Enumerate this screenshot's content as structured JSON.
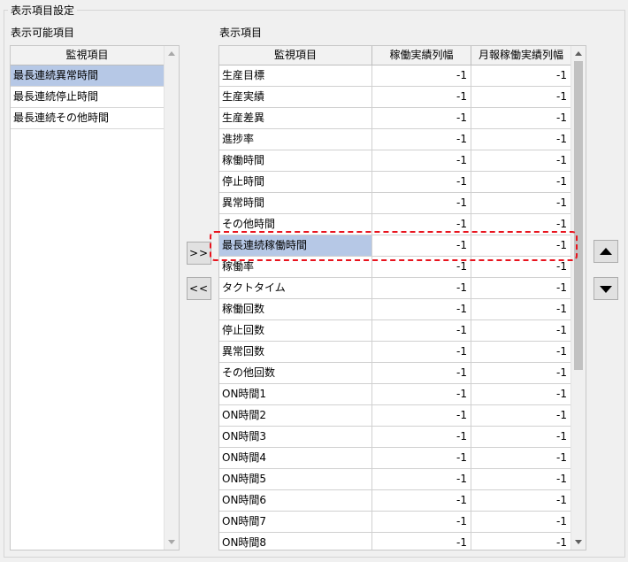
{
  "group": {
    "title": "表示項目設定"
  },
  "available": {
    "label": "表示可能項目",
    "column_header": "監視項目",
    "items": [
      "最長連続異常時間",
      "最長連続停止時間",
      "最長連続その他時間"
    ],
    "selected_index": 0
  },
  "display": {
    "label": "表示項目",
    "columns": [
      "監視項目",
      "稼働実績列幅",
      "月報稼働実績列幅"
    ],
    "rows": [
      {
        "name": "生産目標",
        "w1": "-1",
        "w2": "-1"
      },
      {
        "name": "生産実績",
        "w1": "-1",
        "w2": "-1"
      },
      {
        "name": "生産差異",
        "w1": "-1",
        "w2": "-1"
      },
      {
        "name": "進捗率",
        "w1": "-1",
        "w2": "-1"
      },
      {
        "name": "稼働時間",
        "w1": "-1",
        "w2": "-1"
      },
      {
        "name": "停止時間",
        "w1": "-1",
        "w2": "-1"
      },
      {
        "name": "異常時間",
        "w1": "-1",
        "w2": "-1"
      },
      {
        "name": "その他時間",
        "w1": "-1",
        "w2": "-1"
      },
      {
        "name": "最長連続稼働時間",
        "w1": "-1",
        "w2": "-1"
      },
      {
        "name": "稼働率",
        "w1": "-1",
        "w2": "-1"
      },
      {
        "name": "タクトタイム",
        "w1": "-1",
        "w2": "-1"
      },
      {
        "name": "稼働回数",
        "w1": "-1",
        "w2": "-1"
      },
      {
        "name": "停止回数",
        "w1": "-1",
        "w2": "-1"
      },
      {
        "name": "異常回数",
        "w1": "-1",
        "w2": "-1"
      },
      {
        "name": "その他回数",
        "w1": "-1",
        "w2": "-1"
      },
      {
        "name": "ON時間1",
        "w1": "-1",
        "w2": "-1"
      },
      {
        "name": "ON時間2",
        "w1": "-1",
        "w2": "-1"
      },
      {
        "name": "ON時間3",
        "w1": "-1",
        "w2": "-1"
      },
      {
        "name": "ON時間4",
        "w1": "-1",
        "w2": "-1"
      },
      {
        "name": "ON時間5",
        "w1": "-1",
        "w2": "-1"
      },
      {
        "name": "ON時間6",
        "w1": "-1",
        "w2": "-1"
      },
      {
        "name": "ON時間7",
        "w1": "-1",
        "w2": "-1"
      },
      {
        "name": "ON時間8",
        "w1": "-1",
        "w2": "-1"
      }
    ],
    "highlighted_index": 8
  },
  "buttons": {
    "add": ">>",
    "remove": "<<"
  },
  "icons": {
    "move_up": "triangle-up-icon",
    "move_down": "triangle-down-icon"
  },
  "colors": {
    "selection": "#b6c8e6",
    "annotation": "#e8141e"
  }
}
